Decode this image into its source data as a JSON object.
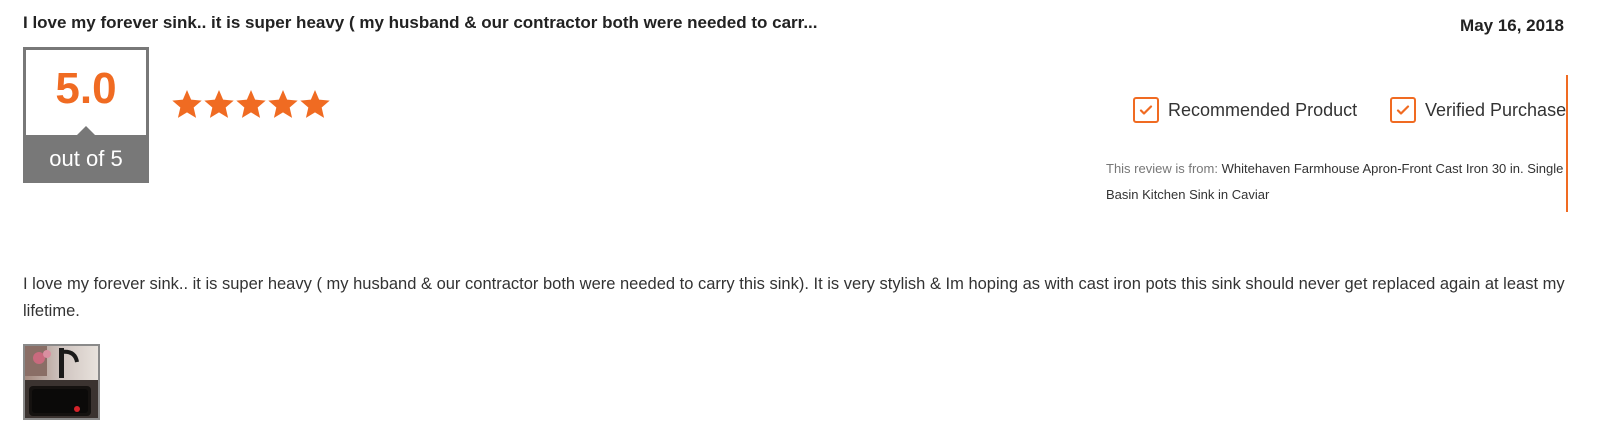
{
  "review": {
    "title": "I love my forever sink.. it is super heavy ( my husband & our contractor both were needed to carr...",
    "date": "May 16, 2018",
    "rating": {
      "value": "5.0",
      "out_of": "out of 5",
      "stars": 5
    },
    "badges": {
      "recommended": "Recommended Product",
      "verified": "Verified Purchase"
    },
    "source": {
      "label": "This review is from:",
      "product": "Whitehaven Farmhouse Apron-Front Cast Iron 30 in. Single Basin Kitchen Sink in Caviar"
    },
    "body": "I love my forever sink.. it is super heavy ( my husband & our contractor both were needed to carry this sink). It is very stylish & Im hoping as with cast iron pots this sink should never get replaced again at least my lifetime.",
    "photos_count": 1
  },
  "colors": {
    "accent": "#f06b22",
    "score_gray": "#787878"
  },
  "icons": {
    "star": "star-icon",
    "check": "check-icon"
  }
}
